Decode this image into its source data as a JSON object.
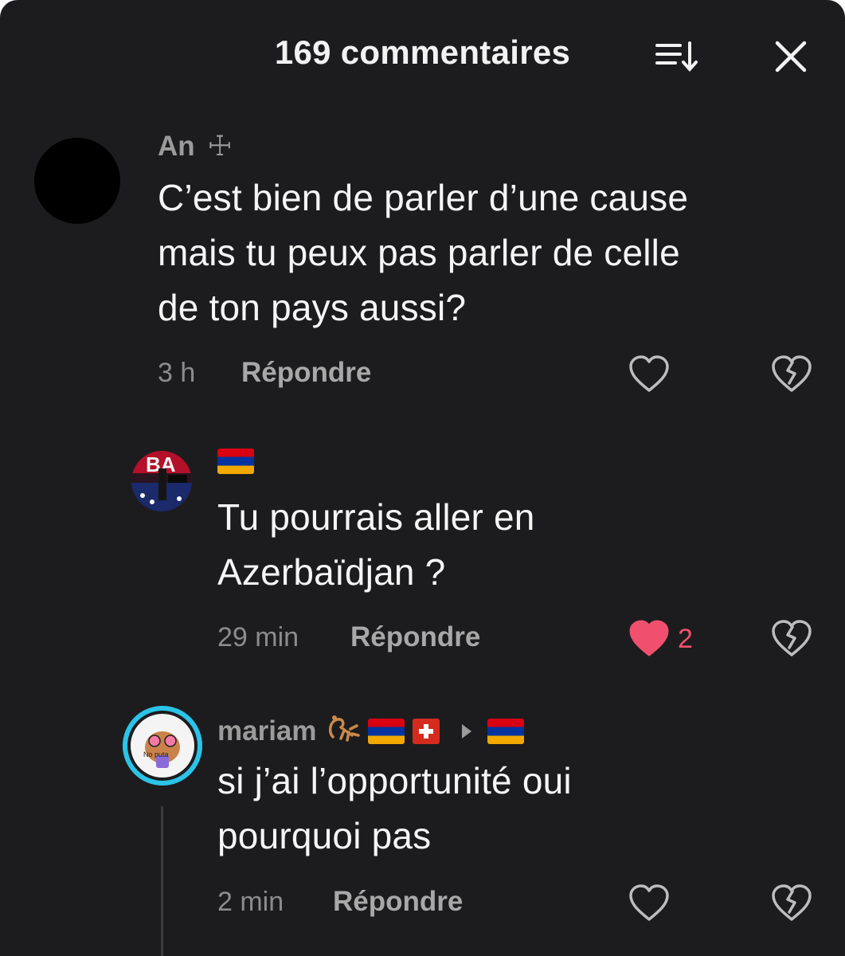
{
  "header": {
    "title": "169 commentaires"
  },
  "comments": [
    {
      "username": "An",
      "username_suffix": "☩",
      "text_lines": [
        "C’est bien de parler d’une cause",
        "mais tu peux pas parler de celle",
        "de ton pays aussi?"
      ],
      "time": "3 h",
      "reply_label": "Répondre",
      "liked": false
    },
    {
      "username_flags": [
        "armenia"
      ],
      "text_lines": [
        "Tu pourrais aller en",
        "Azerbaïdjan ?"
      ],
      "time": "29 min",
      "reply_label": "Répondre",
      "liked": true,
      "like_count": "2"
    },
    {
      "username": "mariam",
      "username_decor": [
        "scorpion",
        "armenia",
        "switzerland",
        "arrow",
        "armenia"
      ],
      "text_lines": [
        "si j’ai l’opportunité oui",
        "pourquoi pas"
      ],
      "time": "2 min",
      "reply_label": "Répondre",
      "liked": false
    }
  ],
  "colors": {
    "background": "#1c1c1e",
    "liked_heart": "#f0506e",
    "text_primary": "#f5f5f5",
    "text_secondary": "#9b9b9b"
  },
  "icons": [
    "sort-icon",
    "close-icon",
    "heart-icon",
    "broken-heart-icon",
    "heart-filled-icon"
  ]
}
